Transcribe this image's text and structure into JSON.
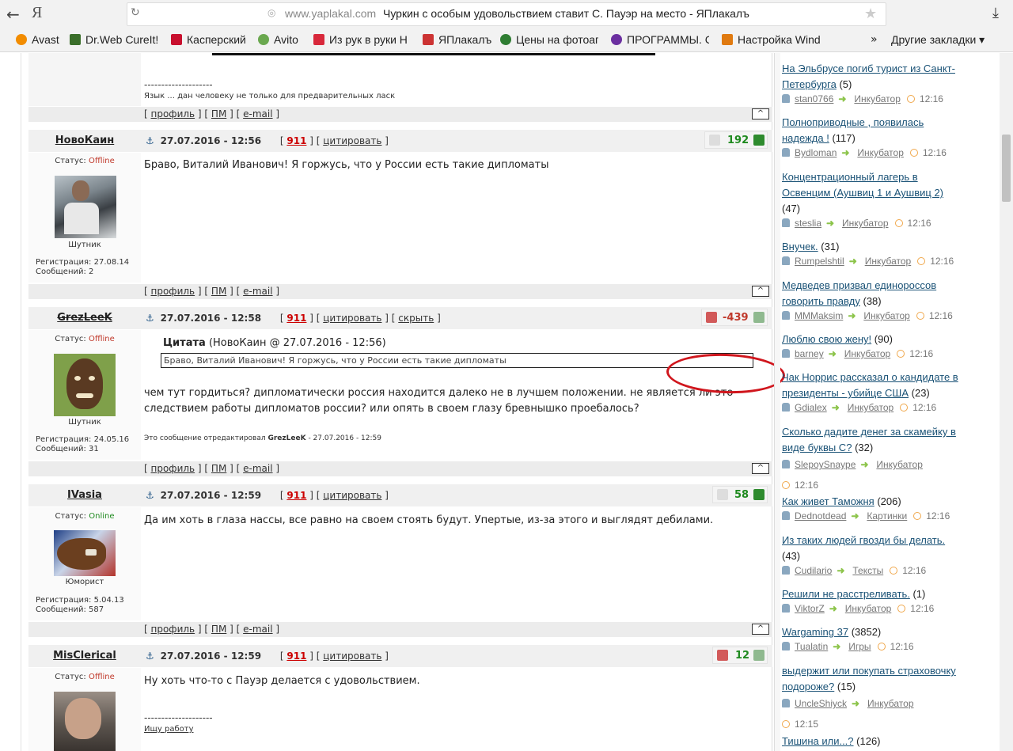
{
  "browser": {
    "url_host": "www.yaplakal.com",
    "tab_title": "Чуркин с особым удовольствием ставит С. Пауэр на место - ЯПлакалъ",
    "logo": "Я",
    "bookmarks": [
      {
        "label": "Avast",
        "color": "#f28c00"
      },
      {
        "label": "Dr.Web CureIt!",
        "color": "#3a6e2a"
      },
      {
        "label": "Касперский",
        "color": "#c8102e"
      },
      {
        "label": "Avito",
        "color": "#6aa84f"
      },
      {
        "label": "Из рук в руки Н",
        "color": "#d8283b"
      },
      {
        "label": "ЯПлакалъ",
        "color": "#c33"
      },
      {
        "label": "Цены на фотоаг",
        "color": "#2f7d32"
      },
      {
        "label": "ПРОГРАММЫ. С",
        "color": "#6b2fa0"
      },
      {
        "label": "Настройка Wind",
        "color": "#e07a10"
      }
    ],
    "more": "»",
    "other_bookmarks": "Другие закладки"
  },
  "prev_post": {
    "separator": "--------------------",
    "signature": "Язык ... дан человеку не только для предварительных ласк",
    "bar": {
      "profile": "профиль",
      "pm": "ПМ",
      "email": "e-mail"
    }
  },
  "posts": [
    {
      "nick": "НовоКаин",
      "date": "27.07.2016 - 12:56",
      "n911": "911",
      "quote": "цитировать",
      "hide": "",
      "score": "192",
      "score_color": "#1f8a1f",
      "status_label": "Статус:",
      "status": "Offline",
      "status_color": "#c0392b",
      "rank": "Шутник",
      "reg": "Регистрация: 27.08.14",
      "msgs": "Сообщений: 2",
      "text": "Браво, Виталий Иванович! Я горжусь, что у России есть такие дипломаты"
    },
    {
      "nick": "GrezLeeK",
      "date": "27.07.2016 - 12:58",
      "n911": "911",
      "quote": "цитировать",
      "hide": "скрыть",
      "score": "-439",
      "score_color": "#c0392b",
      "status_label": "Статус:",
      "status": "Offline",
      "status_color": "#c0392b",
      "rank": "Шутник",
      "reg": "Регистрация: 24.05.16",
      "msgs": "Сообщений: 31",
      "quote_head_b": "Цитата",
      "quote_head": "(НовоКаин @ 27.07.2016 - 12:56)",
      "quote_text": "Браво, Виталий Иванович! Я горжусь, что у России есть такие дипломаты",
      "text1": "чем тут гордиться? дипломатически россия находится далеко не в лучшем положении. не является ли это",
      "text2": "следствием работы дипломатов россии? или опять в своем глазу бревнышко проебалось?",
      "edited_prefix": "Это сообщение отредактировал",
      "edited_nick": "GrezLeeK",
      "edited_date": "- 27.07.2016 - 12:59"
    },
    {
      "nick": "IVasia",
      "date": "27.07.2016 - 12:59",
      "n911": "911",
      "quote": "цитировать",
      "score": "58",
      "score_color": "#1f8a1f",
      "status_label": "Статус:",
      "status": "Online",
      "status_color": "#1f8a1f",
      "rank": "Юморист",
      "reg": "Регистрация: 5.04.13",
      "msgs": "Сообщений: 587",
      "text": "Да им хоть в глаза нассы, все равно на своем стоять будут. Упертые, из-за этого и выглядят дебилами."
    },
    {
      "nick": "MisClerical",
      "date": "27.07.2016 - 12:59",
      "n911": "911",
      "quote": "цитировать",
      "score": "12",
      "score_color": "#1f8a1f",
      "status_label": "Статус:",
      "status": "Offline",
      "status_color": "#c0392b",
      "text": "Ну хоть что-то с Пауэр делается с удовольствием.",
      "separator": "--------------------",
      "signature": "Ищу работу"
    }
  ],
  "bar_labels": {
    "profile": "профиль",
    "pm": "ПМ",
    "email": "e-mail",
    "up": "^"
  },
  "sidebar": [
    {
      "title1": "На Эльбрусе погиб турист из Санкт-",
      "title2": "Петербурга",
      "count": "(5)",
      "user": "stan0766",
      "cat": "Инкубатор",
      "time": "12:16"
    },
    {
      "title1": "Полноприводные , появилась",
      "title2": "надежда !",
      "count": "(117)",
      "user": "Bydloman",
      "cat": "Инкубатор",
      "time": "12:16"
    },
    {
      "title1": "Концентрационный лагерь в",
      "title2": "Освенцим (Аушвиц 1 и Аушвиц 2)",
      "count": "(47)",
      "user": "steslia",
      "cat": "Инкубатор",
      "time": "12:16"
    },
    {
      "title1": "Внучек.",
      "title2": "",
      "count": "(31)",
      "user": "Rumpelshtil",
      "cat": "Инкубатор",
      "time": "12:16"
    },
    {
      "title1": "Медведев призвал единороссов",
      "title2": "говорить правду",
      "count": "(38)",
      "user": "MMMaksim",
      "cat": "Инкубатор",
      "time": "12:16"
    },
    {
      "title1": "Люблю свою жену!",
      "title2": "",
      "count": "(90)",
      "user": "barney",
      "cat": "Инкубатор",
      "time": "12:16"
    },
    {
      "title1": "Чак Норрис рассказал о кандидате в",
      "title2": "президенты - убийце США",
      "count": "(23)",
      "user": "Gdialex",
      "cat": "Инкубатор",
      "time": "12:16"
    },
    {
      "title1": "Сколько дадите денег за скамейку в",
      "title2": "виде буквы С?",
      "count": "(32)",
      "user": "SlepoySnaype",
      "cat": "Инкубатор",
      "time": "12:16"
    },
    {
      "title1": "Как живет Таможня",
      "title2": "",
      "count": "(206)",
      "user": "Dednotdead",
      "cat": "Картинки",
      "time": "12:16"
    },
    {
      "title1": "Из таких людей гвозди бы делать.",
      "title2": "",
      "count": "(43)",
      "user": "Cudilario",
      "cat": "Тексты",
      "time": "12:16"
    },
    {
      "title1": "Решили не расстреливать.",
      "title2": "",
      "count": "(1)",
      "user": "ViktorZ",
      "cat": "Инкубатор",
      "time": "12:16"
    },
    {
      "title1": "Wargaming 37",
      "title2": "",
      "count": "(3852)",
      "user": "Tualatin",
      "cat": "Игры",
      "time": "12:16"
    },
    {
      "title1": "выдержит или покупать страховочку",
      "title2": "подороже?",
      "count": "(15)",
      "user": "UncleShiyck",
      "cat": "Инкубатор",
      "time": "12:15"
    },
    {
      "title1": "Тишина или...?",
      "title2": "",
      "count": "(126)",
      "user": "",
      "cat": "",
      "time": ""
    }
  ]
}
